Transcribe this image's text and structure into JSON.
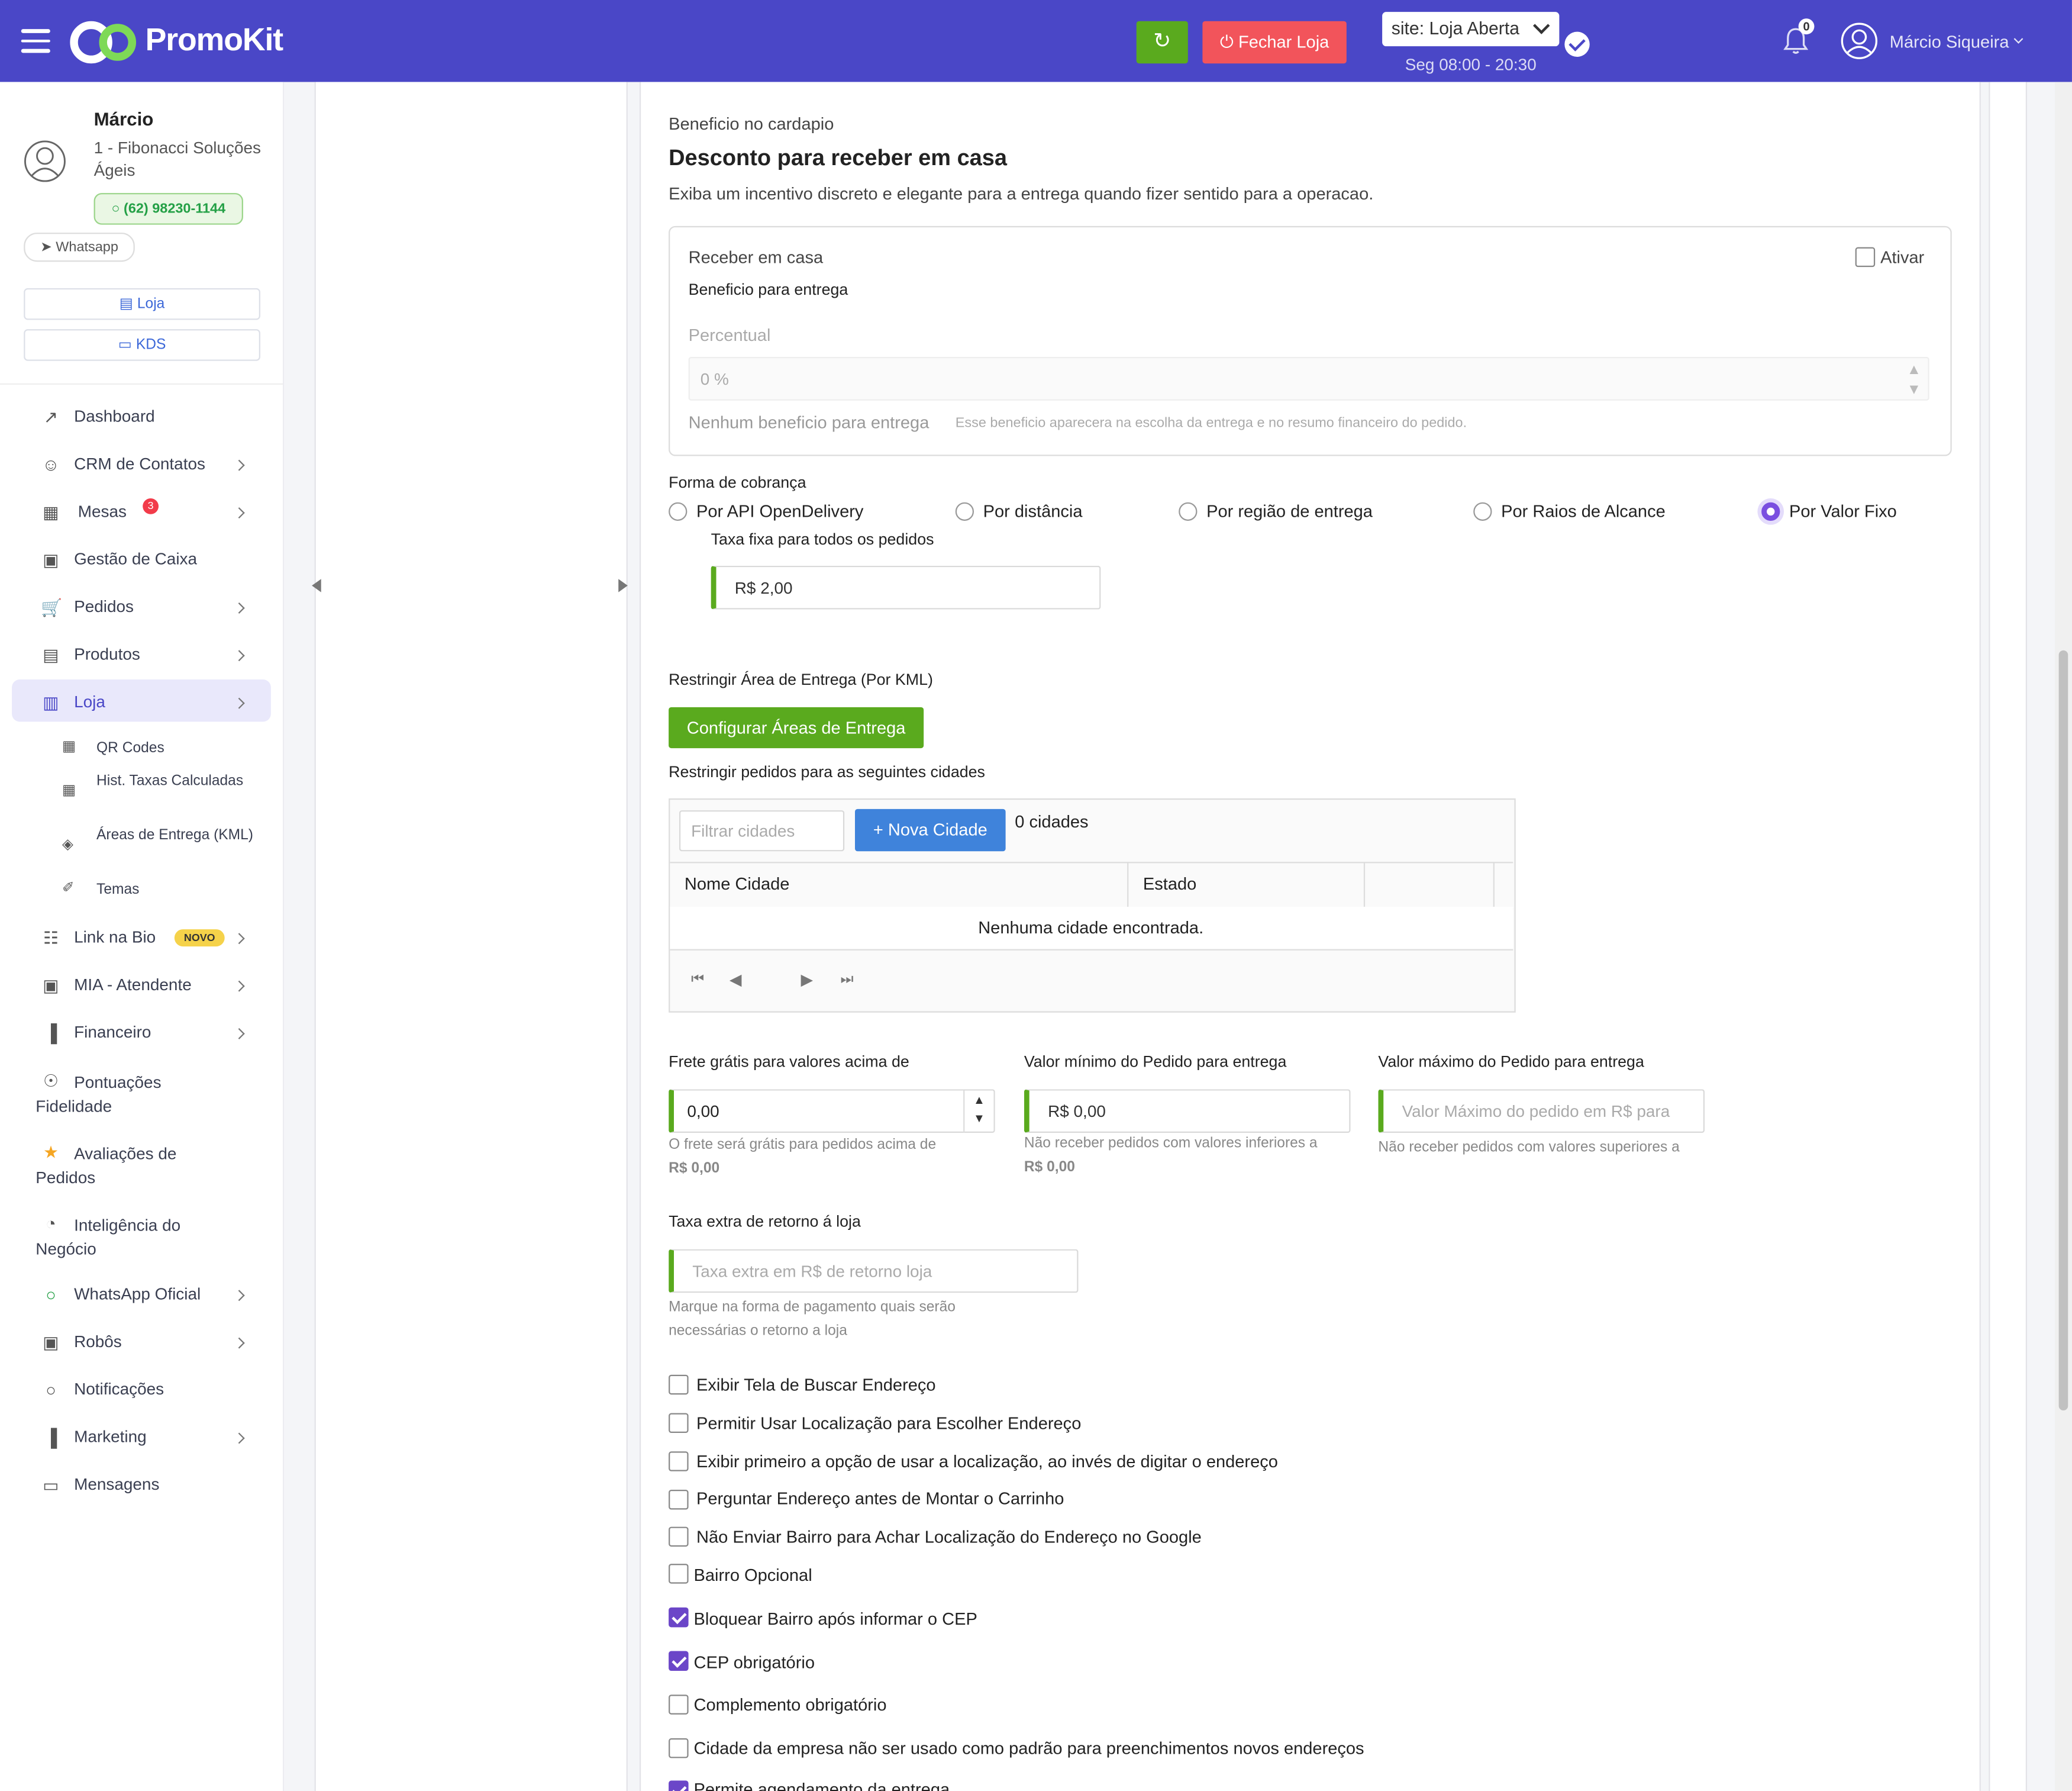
{
  "header": {
    "brand": "PromoKit",
    "close_store": "Fechar Loja",
    "site_status": "site: Loja Aberta",
    "hours": "Seg 08:00 - 20:30",
    "notifications_count": "0",
    "user_name": "Márcio Siqueira",
    "colors": {
      "bar": "#4a47c7",
      "refresh": "#5aaa1e",
      "close": "#f2545b"
    }
  },
  "sidebar": {
    "name": "Márcio",
    "company": "1 - Fibonacci Soluções Ágeis",
    "phone": "(62) 98230-1144",
    "whatsapp": "Whatsapp",
    "loja_btn": "Loja",
    "kds_btn": "KDS",
    "items": [
      {
        "label": "Dashboard",
        "icon": "chart-line-icon"
      },
      {
        "label": "CRM de Contatos",
        "icon": "users-icon"
      },
      {
        "label": "Mesas",
        "icon": "table-icon",
        "badge": "3"
      },
      {
        "label": "Gestão de Caixa",
        "icon": "cash-register-icon"
      },
      {
        "label": "Pedidos",
        "icon": "cart-icon"
      },
      {
        "label": "Produtos",
        "icon": "boxes-icon"
      },
      {
        "label": "Loja",
        "icon": "building-icon"
      },
      {
        "label": "Link na Bio",
        "icon": "sitemap-icon",
        "badge": "NOVO"
      },
      {
        "label": "MIA - Atendente",
        "icon": "robot-icon"
      },
      {
        "label": "Financeiro",
        "icon": "bar-chart-icon"
      },
      {
        "label": "Pontuações Fidelidade",
        "icon": "medal-icon"
      },
      {
        "label": "Avaliações de Pedidos",
        "icon": "star-icon"
      },
      {
        "label": "Inteligência do Negócio",
        "icon": "pie-chart-icon"
      },
      {
        "label": "WhatsApp Oficial",
        "icon": "whatsapp-icon"
      },
      {
        "label": "Robôs",
        "icon": "robot-icon"
      },
      {
        "label": "Notificações",
        "icon": "whatsapp-icon"
      },
      {
        "label": "Marketing",
        "icon": "bar-chart-icon"
      },
      {
        "label": "Mensagens",
        "icon": "inbox-icon"
      }
    ],
    "loja_sub": [
      {
        "label": "QR Codes",
        "icon": "qrcode-icon"
      },
      {
        "label": "Hist. Taxas Calculadas",
        "icon": "calculator-icon"
      },
      {
        "label": "Áreas de Entrega (KML)",
        "icon": "map-icon"
      },
      {
        "label": "Temas",
        "icon": "paint-roller-icon"
      }
    ]
  },
  "main": {
    "benefit_kicker": "Beneficio no cardapio",
    "benefit_title": "Desconto para receber em casa",
    "benefit_desc": "Exiba um incentivo discreto e elegante para a entrega quando fizer sentido para a operacao.",
    "card": {
      "title": "Receber em casa",
      "activate": "Ativar",
      "subtitle": "Beneficio para entrega",
      "percent_label": "Percentual",
      "percent_value": "0 %",
      "empty": "Nenhum beneficio para entrega",
      "hint": "Esse beneficio aparecera na escolha da entrega e no resumo financeiro do pedido."
    },
    "charge_label": "Forma de cobrança",
    "charge_options": [
      "Por API OpenDelivery",
      "Por distância",
      "Por região de entrega",
      "Por Raios de Alcance",
      "Por Valor Fixo"
    ],
    "charge_selected": "Por Valor Fixo",
    "fixed_fee_label": "Taxa fixa para todos os pedidos",
    "fixed_fee_value": "R$ 2,00",
    "kml_label": "Restringir Área de Entrega (Por KML)",
    "kml_button": "Configurar Áreas de Entrega",
    "cities_label": "Restringir pedidos para as seguintes cidades",
    "cities_filter_placeholder": "Filtrar cidades",
    "new_city_button": "+ Nova Cidade",
    "cities_count": "0 cidades",
    "cities_columns": [
      "Nome Cidade",
      "Estado"
    ],
    "cities_empty": "Nenhuma cidade encontrada.",
    "free_shipping_label": "Frete grátis para valores acima de",
    "free_shipping_value": "0,00",
    "free_shipping_help": "O frete será grátis para pedidos acima de",
    "free_shipping_help_value": "R$ 0,00",
    "min_order_label": "Valor mínimo do Pedido para entrega",
    "min_order_value": "R$ 0,00",
    "min_order_help": "Não receber pedidos com valores inferiores a",
    "min_order_help_value": "R$ 0,00",
    "max_order_label": "Valor máximo do Pedido para entrega",
    "max_order_placeholder": "Valor Máximo do pedido em R$ para",
    "max_order_help": "Não receber pedidos com valores superiores a",
    "return_fee_label": "Taxa extra de retorno á loja",
    "return_fee_placeholder": "Taxa extra em R$ de retorno loja",
    "return_fee_help": "Marque na forma de pagamento quais serão necessárias o retorno a loja",
    "options": [
      {
        "label": "Exibir Tela de Buscar Endereço",
        "checked": false
      },
      {
        "label": "Permitir Usar Localização para Escolher Endereço",
        "checked": false
      },
      {
        "label": "Exibir primeiro a opção de usar a localização, ao invés de digitar o endereço",
        "checked": false
      },
      {
        "label": "Perguntar Endereço antes de Montar o Carrinho",
        "checked": false
      },
      {
        "label": "Não Enviar Bairro para Achar Localização do Endereço no Google",
        "checked": false
      },
      {
        "label": "Bairro Opcional",
        "checked": false
      },
      {
        "label": "Bloquear Bairro após informar o CEP",
        "checked": true
      },
      {
        "label": "CEP obrigatório",
        "checked": true
      },
      {
        "label": "Complemento obrigatório",
        "checked": false
      },
      {
        "label": "Cidade da empresa não ser usado como padrão para preenchimentos novos endereços",
        "checked": false
      },
      {
        "label": "Permite agendamento da entrega",
        "checked": true
      }
    ]
  }
}
